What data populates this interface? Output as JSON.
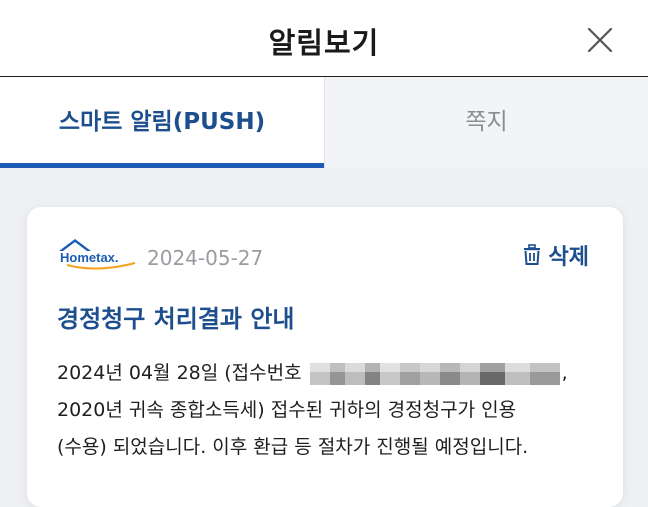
{
  "header": {
    "title": "알림보기",
    "close_icon": "close-icon"
  },
  "tabs": [
    {
      "label": "스마트 알림(PUSH)",
      "active": true
    },
    {
      "label": "쪽지",
      "active": false
    }
  ],
  "colors": {
    "accent": "#1c5bb6",
    "title_blue": "#1d4f8f",
    "background": "#eef0f4"
  },
  "notification": {
    "brand": "Hometax.",
    "date": "2024-05-27",
    "delete_label": "삭제",
    "delete_icon": "trash-icon",
    "title": "경정청구 처리결과 안내",
    "body": {
      "line1_before": "2024년 04월 28일 (접수번호",
      "line1_after": ",",
      "line2": "2020년 귀속 종합소득세) 접수된 귀하의 경정청구가 인용",
      "line3": "(수용) 되었습니다. 이후 환급 등 절차가 진행될 예정입니다."
    }
  }
}
